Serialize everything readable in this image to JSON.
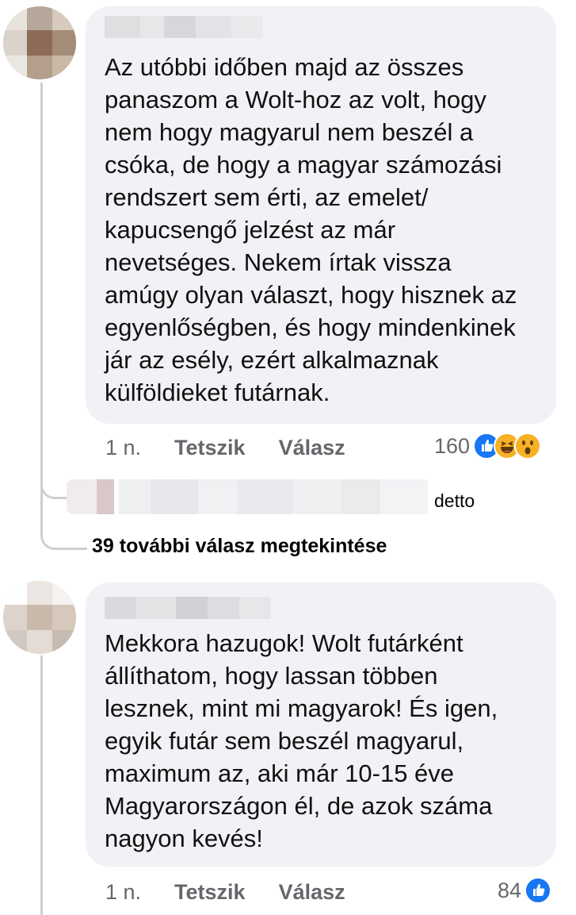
{
  "comments": [
    {
      "text": "Az utóbbi időben majd az összes\npanaszom a Wolt-hoz az volt, hogy\nnem hogy magyarul nem beszél a\ncsóka, de hogy a magyar számozási\nrendszert sem érti, az emelet/\nkapucsengő jelzést az már\nnevetséges. Nekem írtak vissza\namúgy olyan választ, hogy hisznek az\negyenlőségben, és hogy mindenkinek\njár az esély, ezért alkalmaznak\nkülföldieket futárnak.",
      "time": "1 n.",
      "like_label": "Tetszik",
      "reply_label": "Válasz",
      "reaction_count": "160",
      "reactions": [
        "like-icon",
        "haha-icon",
        "wow-icon"
      ],
      "reply_preview": {
        "text": "detto"
      },
      "more_replies_label": "39 további válasz megtekintése"
    },
    {
      "text": "Mekkora hazugok! Wolt futárként\nállíthatom, hogy lassan többen\nlesznek, mint mi magyarok! És igen,\negyik futár sem beszél magyarul,\nmaximum az, aki már 10-15 éve\nMagyarországon él, de azok száma\nnagyon kevés!",
      "time": "1 n.",
      "like_label": "Tetszik",
      "reply_label": "Válasz",
      "reaction_count": "84",
      "reactions": [
        "like-icon"
      ]
    }
  ],
  "colors": {
    "bubble": "#f0f2f5",
    "meta_text": "#65676b",
    "like_blue": "#1877f2",
    "reaction_yellow": "#f7b125",
    "thread_line": "#ccd0d5"
  }
}
